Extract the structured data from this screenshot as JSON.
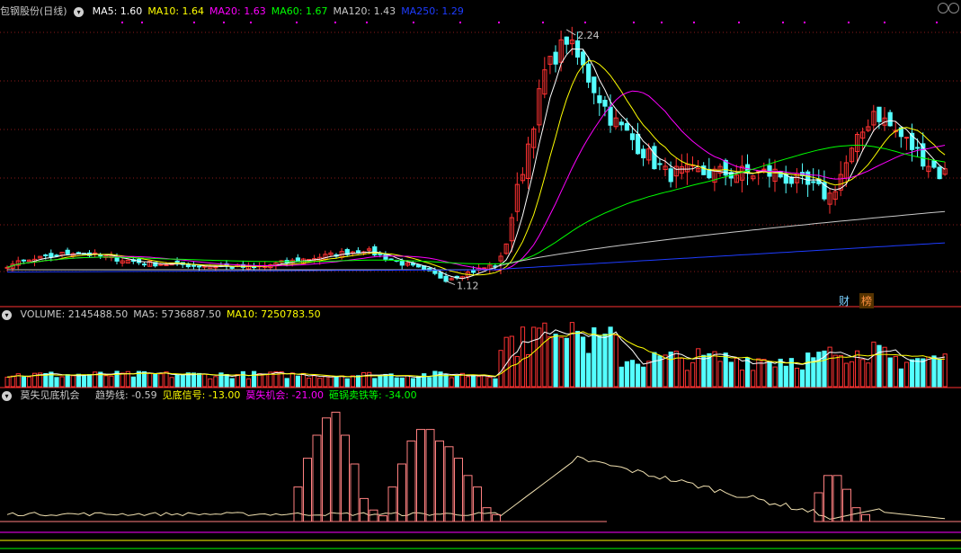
{
  "main": {
    "title": "包钢股份(日线)",
    "ma_labels": [
      {
        "text": "MA5: 1.60",
        "color": "#ffffff"
      },
      {
        "text": "MA10: 1.64",
        "color": "#ffff00"
      },
      {
        "text": "MA20: 1.63",
        "color": "#ff00ff"
      },
      {
        "text": "MA60: 1.67",
        "color": "#00ff00"
      },
      {
        "text": "MA120: 1.43",
        "color": "#c8c8c8"
      },
      {
        "text": "MA250: 1.29",
        "color": "#1e3cff"
      }
    ],
    "price_high_label": "2.24",
    "price_low_label": "1.12",
    "tags": {
      "finance": "财",
      "rank": "榜"
    }
  },
  "volume": {
    "labels": [
      {
        "text": "VOLUME: 2145488.50",
        "color": "#c8c8c8"
      },
      {
        "text": "MA5: 5736887.50",
        "color": "#c8c8c8"
      },
      {
        "text": "MA10: 7250783.50",
        "color": "#ffff00"
      }
    ]
  },
  "indicator": {
    "name": "莫失见底机会",
    "labels": [
      {
        "text": "趋势线: -0.59",
        "color": "#c8c8c8"
      },
      {
        "text": "见底信号: -13.00",
        "color": "#ffff00"
      },
      {
        "text": "莫失机会: -21.00",
        "color": "#ff00ff"
      },
      {
        "text": "砸锅卖铁等: -34.00",
        "color": "#00ff00"
      }
    ]
  },
  "colors": {
    "up": "#ff3232",
    "down": "#54ffff",
    "grid": "#8b1a1a",
    "ma5": "#ffffff",
    "ma10": "#ffff00",
    "ma20": "#ff00ff",
    "ma60": "#00ff00",
    "ma120": "#c8c8c8",
    "ma250": "#1e3cff",
    "indicator_bar": "#ff8080",
    "trend": "#f0e0b0"
  },
  "chart_data": {
    "type": "candlestick",
    "price_range": [
      1.05,
      2.3
    ],
    "candles_keypoints": [
      {
        "t": 0,
        "close": 1.19
      },
      {
        "t": 12,
        "close": 1.25
      },
      {
        "t": 25,
        "close": 1.2
      },
      {
        "t": 45,
        "close": 1.18
      },
      {
        "t": 65,
        "close": 1.26
      },
      {
        "t": 80,
        "close": 1.13
      },
      {
        "t": 90,
        "close": 1.2
      },
      {
        "t": 98,
        "close": 2.05
      },
      {
        "t": 102,
        "close": 2.2
      },
      {
        "t": 110,
        "close": 1.85
      },
      {
        "t": 120,
        "close": 1.6
      },
      {
        "t": 140,
        "close": 1.6
      },
      {
        "t": 150,
        "close": 1.5
      },
      {
        "t": 158,
        "close": 1.88
      },
      {
        "t": 170,
        "close": 1.6
      }
    ],
    "ma120_end": 1.43,
    "ma250_end": 1.29,
    "indicator_bar_groups": [
      {
        "values": [
          0.3,
          0.55,
          0.75,
          0.9,
          0.95,
          0.75,
          0.5,
          0.2,
          0.1,
          0.05
        ]
      },
      {
        "values": [
          0.3,
          0.5,
          0.7,
          0.8,
          0.8,
          0.7,
          0.65,
          0.55,
          0.4,
          0.3,
          0.12,
          0.06
        ]
      },
      {
        "values": [
          0.25,
          0.4,
          0.4,
          0.28,
          0.12,
          0.06
        ]
      }
    ]
  }
}
